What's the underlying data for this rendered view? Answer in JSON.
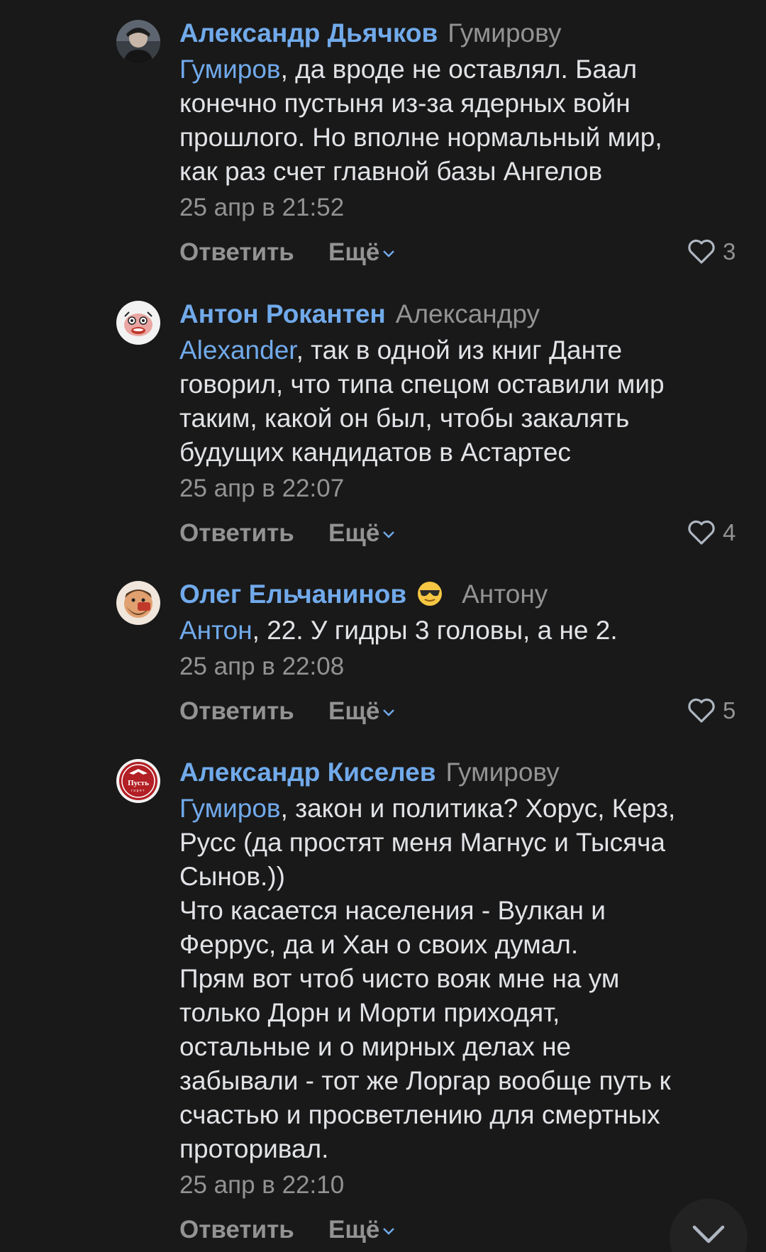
{
  "comments": [
    {
      "author": "Александр Дьячков",
      "reply_to": "Гумирову",
      "mention": "Гумиров",
      "text_lines": [
        ", да вроде не оставлял. Баал",
        "конечно пустыня из-за ядерных войн",
        "прошлого. Но вполне нормальный мир,",
        "как раз счет главной базы Ангелов"
      ],
      "time": "25 апр в 21:52",
      "likes": "3"
    },
    {
      "author": "Антон Рокантен",
      "reply_to": "Александру",
      "mention": "Alexander",
      "text_lines": [
        ", так в одной из книг Данте",
        "говорил, что типа спецом оставили мир",
        "таким, какой он был, чтобы закалять",
        "будущих кандидатов в Астартес"
      ],
      "time": "25 апр в 22:07",
      "likes": "4"
    },
    {
      "author": "Олег Ельчанинов",
      "author_emoji": "sunglasses-emoji",
      "reply_to": "Антону",
      "mention": "Антон",
      "text_lines": [
        ", 22. У гидры 3 головы, а не 2."
      ],
      "time": "25 апр в 22:08",
      "likes": "5"
    },
    {
      "author": "Александр Киселев",
      "reply_to": "Гумирову",
      "mention": "Гумиров",
      "text_lines": [
        ", закон и политика? Хорус, Керз,",
        "Русс (да простят меня Магнус и Тысяча",
        "Сынов.))",
        "Что касается населения - Вулкан и",
        "Феррус, да и Хан о своих думал.",
        "Прям вот чтоб чисто вояк мне на ум",
        "только Дорн и Морти приходят,",
        "остальные и о мирных делах не",
        "забывали - тот же Лоргар вообще путь к",
        "счастью и просветлению для смертных",
        "проторивал."
      ],
      "time": "25 апр в 22:10",
      "avatar_text": "Пусть",
      "avatar_subtext": "горят"
    }
  ],
  "actions": {
    "reply": "Ответить",
    "more": "Ещё"
  },
  "colors": {
    "background": "#191919",
    "link": "#71aaeb",
    "secondary": "#939393",
    "text": "#e1e3e6"
  },
  "icons": {
    "like": "heart-icon",
    "more": "chevron-down-icon",
    "scroll": "chevron-down-icon"
  }
}
